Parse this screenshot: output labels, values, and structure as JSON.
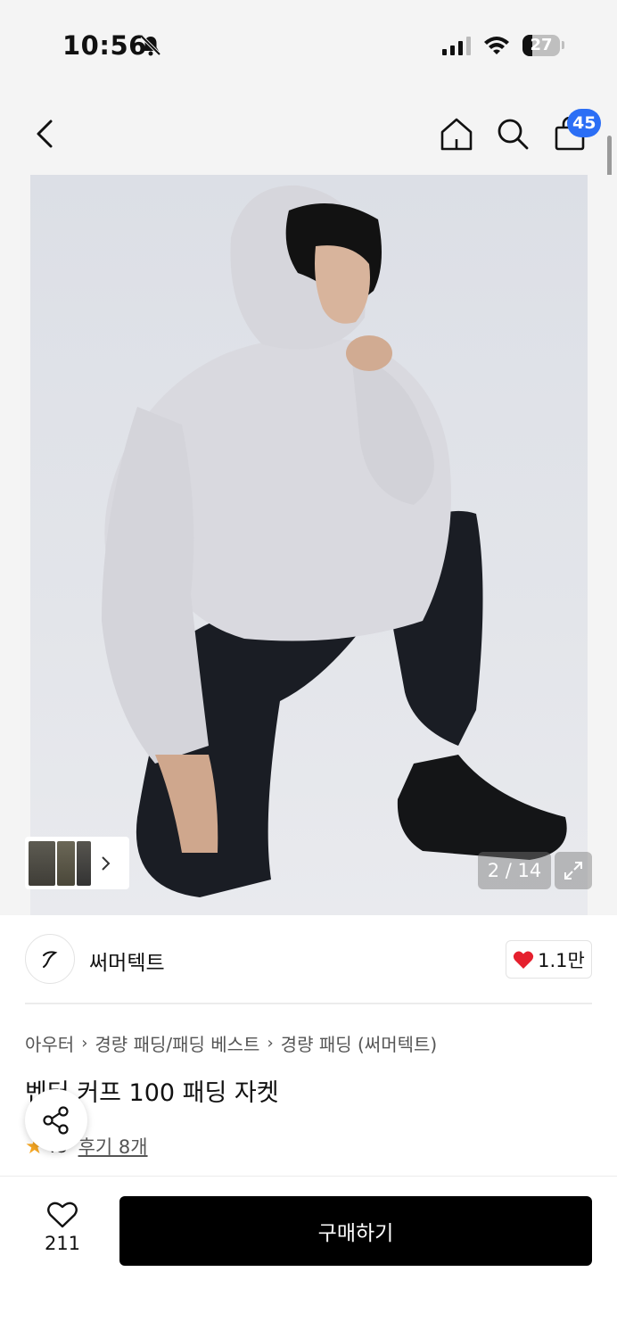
{
  "status_bar": {
    "time": "10:56",
    "battery": "27",
    "battery_level": 0.27,
    "icons": [
      "bell-off-icon",
      "signal-icon",
      "wifi-icon",
      "battery-icon"
    ]
  },
  "nav": {
    "icons": [
      "back-icon",
      "home-icon",
      "search-icon",
      "cart-icon"
    ],
    "cart_count": "45"
  },
  "gallery": {
    "page_indicator": "2 / 14",
    "thumb_next_icon": "chevron-right-icon",
    "expand_icon": "expand-icon"
  },
  "brand": {
    "name": "써머텍트",
    "likes": "1.1만",
    "like_icon": "heart-filled-icon"
  },
  "product": {
    "breadcrumb": [
      "아우터",
      "경량 패딩/패딩 베스트",
      "경량 패딩 (써머텍트)"
    ],
    "title": "벤터 커프 100 패딩 자켓",
    "rating": ".8",
    "review_label": "후기 8개"
  },
  "actions": {
    "wish_count": "211",
    "buy_label": "구매하기"
  },
  "colors": {
    "accent_blue": "#2b6ef5",
    "heart_red": "#e5202e",
    "star_orange": "#f5a623",
    "buy_button": "#000000"
  }
}
